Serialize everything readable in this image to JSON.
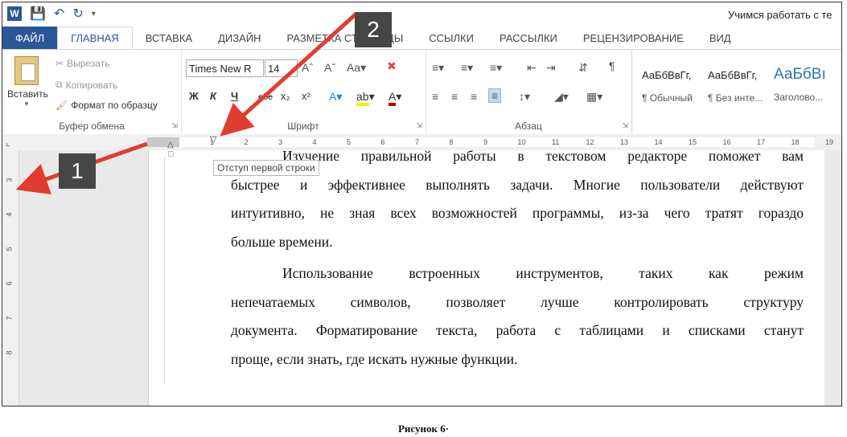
{
  "window": {
    "doc_title": "Учимся работать с те"
  },
  "tabs": [
    {
      "label": "ФАЙЛ"
    },
    {
      "label": "ГЛАВНАЯ"
    },
    {
      "label": "ВСТАВКА"
    },
    {
      "label": "ДИЗАЙН"
    },
    {
      "label": "РАЗМЕТКА СТРАНИЦЫ"
    },
    {
      "label": "ССЫЛКИ"
    },
    {
      "label": "РАССЫЛКИ"
    },
    {
      "label": "РЕЦЕНЗИРОВАНИЕ"
    },
    {
      "label": "ВИД"
    }
  ],
  "ribbon": {
    "clipboard": {
      "paste": "Вставить",
      "cut": "Вырезать",
      "copy": "Копировать",
      "format_painter": "Формат по образцу",
      "label": "Буфер обмена"
    },
    "font": {
      "font_name": "Times New R",
      "font_size": "14",
      "bold": "Ж",
      "italic": "К",
      "underline": "Ч",
      "strike": "abc",
      "subscript": "x₂",
      "superscript": "x²",
      "label": "Шрифт"
    },
    "paragraph": {
      "label": "Абзац"
    },
    "styles": [
      {
        "sample": "АаБбВвГг,",
        "name": "¶ Обычный"
      },
      {
        "sample": "АаБбВвГг,",
        "name": "¶ Без инте..."
      },
      {
        "sample": "АаБбВı",
        "name": "Заголово..."
      }
    ]
  },
  "ruler": {
    "ticks": [
      "1",
      "2",
      "3",
      "4",
      "5",
      "6",
      "7",
      "8",
      "9",
      "10",
      "11",
      "12",
      "13",
      "14",
      "15",
      "16",
      "17",
      "18",
      "19"
    ],
    "vticks": [
      "3",
      "4",
      "5",
      "6",
      "7",
      "8"
    ],
    "tooltip": "Отступ первой строки"
  },
  "document": {
    "lines": [
      "Изучение правильной работы в текстовом редакторе поможет вам",
      "быстрее и эффективнее выполнять задачи. Многие пользователи действуют",
      "интуитивно, не зная всех возможностей программы, из-за чего тратят гораздо",
      "больше времени.",
      "Использование встроенных инструментов, таких как режим",
      "непечатаемых символов, позволяет лучше контролировать структуру",
      "документа. Форматирование текста, работа с таблицами и списками станут",
      "проще, если знать, где искать нужные функции."
    ]
  },
  "annotations": {
    "badge1": "1",
    "badge2": "2"
  },
  "caption": "Рисунок 6·",
  "colors": {
    "accent": "#2b579a",
    "arrow": "#e03c31",
    "badge": "#464646"
  }
}
